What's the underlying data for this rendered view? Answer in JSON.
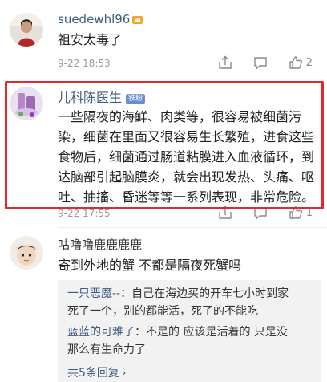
{
  "comments": [
    {
      "username": "suedewhl96",
      "text": "祖安太毒了",
      "time": "9-22 18:53",
      "like_count": "2"
    },
    {
      "username": "儿科陈医生",
      "badge": "铁粉",
      "text_lines": [
        "一些隔夜的海鲜、肉类等，很容易被细菌污",
        "染，细菌在里面又很容易生长繁殖，进食这些",
        "食物后，细菌通过肠道粘膜进入血液循环，到",
        "达脑部引起脑膜炎，就会出现发热、头痛、呕",
        "吐、抽搐、昏迷等等一系列表现，非常危险。"
      ],
      "time": "9-22 17:55",
      "like_count": "1"
    },
    {
      "username": "咕噜噜鹿鹿鹿鹿",
      "text": "寄到外地的蟹 不都是隔夜死蟹吗",
      "replies": [
        {
          "name": "一只恶魔--",
          "line1": "：自己在海边买的开车七小时到家",
          "line2": "死了一个，别的都能活，死了的不能吃"
        },
        {
          "name": "蓝蓝的可难了",
          "line1": "：不是的 应该是活着的 只是没",
          "line2": "那么有生命力了"
        }
      ],
      "more_label": "共5条回复",
      "more_arrow": "›"
    }
  ],
  "colors": {
    "username": "#3d5a80",
    "highlight_border": "#e8262b",
    "meta": "#9a9a9a"
  },
  "icons": [
    "share-icon",
    "comment-icon",
    "like-icon",
    "vip-crown-icon"
  ]
}
